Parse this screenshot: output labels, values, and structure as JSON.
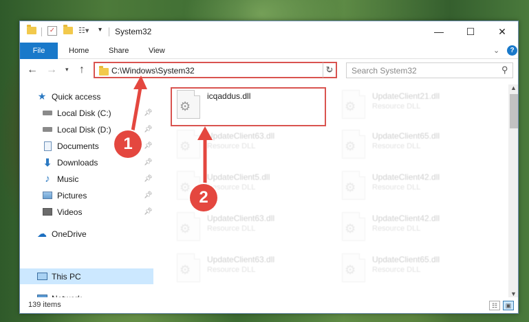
{
  "window": {
    "title": "System32"
  },
  "ribbon": {
    "file_label": "File",
    "tabs": [
      "Home",
      "Share",
      "View"
    ]
  },
  "address": {
    "path": "C:\\Windows\\System32",
    "search_placeholder": "Search System32"
  },
  "sidebar": {
    "items": [
      {
        "label": "Quick access",
        "icon": "star-icon",
        "pinned": false
      },
      {
        "label": "Local Disk (C:)",
        "icon": "drive-icon",
        "pinned": true
      },
      {
        "label": "Local Disk (D:)",
        "icon": "drive-icon",
        "pinned": true
      },
      {
        "label": "Documents",
        "icon": "documents-icon",
        "pinned": true
      },
      {
        "label": "Downloads",
        "icon": "download-arrow-icon",
        "pinned": true
      },
      {
        "label": "Music",
        "icon": "music-note-icon",
        "pinned": true
      },
      {
        "label": "Pictures",
        "icon": "pictures-icon",
        "pinned": true
      },
      {
        "label": "Videos",
        "icon": "videos-icon",
        "pinned": true
      },
      {
        "label": "OneDrive",
        "icon": "cloud-icon",
        "pinned": false
      },
      {
        "label": "This PC",
        "icon": "monitor-icon",
        "pinned": false,
        "selected": true
      },
      {
        "label": "Network",
        "icon": "network-icon",
        "pinned": false
      }
    ]
  },
  "files": {
    "highlighted": {
      "name": "icqaddus.dll"
    },
    "others": [
      {
        "name": "UpdateClient21.dll",
        "type": "Resource DLL"
      },
      {
        "name": "UpdateClient63.dll",
        "type": "Resource DLL"
      },
      {
        "name": "UpdateClient65.dll",
        "type": "Resource DLL"
      },
      {
        "name": "UpdateClient5.dll",
        "type": "Resource DLL"
      },
      {
        "name": "UpdateClient42.dll",
        "type": "Resource DLL"
      },
      {
        "name": "UpdateClient63.dll",
        "type": "Resource DLL"
      },
      {
        "name": "UpdateClient42.dll",
        "type": "Resource DLL"
      },
      {
        "name": "UpdateClient63.dll",
        "type": "Resource DLL"
      },
      {
        "name": "UpdateClient65.dll",
        "type": "Resource DLL"
      }
    ]
  },
  "status": {
    "count": "139 items"
  },
  "markers": [
    "1",
    "2"
  ],
  "colors": {
    "accent": "#1979ca",
    "highlight": "#d9534f",
    "selection": "#cce8ff"
  }
}
